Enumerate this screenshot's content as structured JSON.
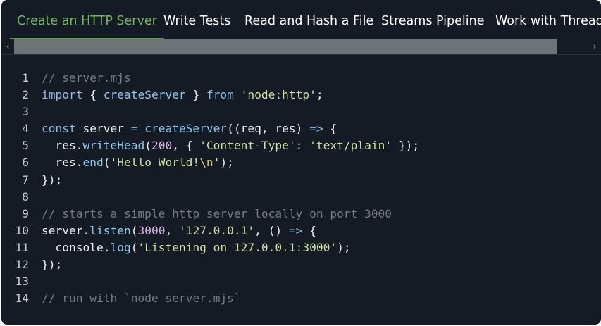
{
  "tabs": [
    {
      "label": "Create an HTTP Server",
      "active": true
    },
    {
      "label": "Write Tests",
      "active": false
    },
    {
      "label": "Read and Hash a File",
      "active": false
    },
    {
      "label": "Streams Pipeline",
      "active": false
    },
    {
      "label": "Work with Threads",
      "active": false
    }
  ],
  "scrollbar": {
    "left_arrow": "‹",
    "right_arrow": "›"
  },
  "colors": {
    "background": "#141b24",
    "active_tab": "#77b564",
    "comment": "#717b87",
    "keyword": "#8fb8e0",
    "string": "#c9e0a4",
    "number": "#dcb3e8",
    "function": "#8fc6f0"
  },
  "code": {
    "language": "javascript",
    "lines": [
      {
        "n": "1",
        "tokens": [
          [
            "comment",
            "// server.mjs"
          ]
        ]
      },
      {
        "n": "2",
        "tokens": [
          [
            "keyword",
            "import"
          ],
          [
            "plain",
            " { "
          ],
          [
            "func",
            "createServer"
          ],
          [
            "plain",
            " } "
          ],
          [
            "keyword",
            "from"
          ],
          [
            "plain",
            " "
          ],
          [
            "string",
            "'node:http'"
          ],
          [
            "plain",
            ";"
          ]
        ]
      },
      {
        "n": "3",
        "tokens": []
      },
      {
        "n": "4",
        "tokens": [
          [
            "keyword",
            "const"
          ],
          [
            "plain",
            " server "
          ],
          [
            "op",
            "="
          ],
          [
            "plain",
            " "
          ],
          [
            "func",
            "createServer"
          ],
          [
            "plain",
            "((req, res) "
          ],
          [
            "op",
            "=>"
          ],
          [
            "plain",
            " {"
          ]
        ]
      },
      {
        "n": "5",
        "tokens": [
          [
            "plain",
            "  res."
          ],
          [
            "func",
            "writeHead"
          ],
          [
            "plain",
            "("
          ],
          [
            "number",
            "200"
          ],
          [
            "plain",
            ", { "
          ],
          [
            "string",
            "'Content-Type'"
          ],
          [
            "plain",
            ": "
          ],
          [
            "string",
            "'text/plain'"
          ],
          [
            "plain",
            " });"
          ]
        ]
      },
      {
        "n": "6",
        "tokens": [
          [
            "plain",
            "  res."
          ],
          [
            "func",
            "end"
          ],
          [
            "plain",
            "("
          ],
          [
            "string",
            "'Hello World!"
          ],
          [
            "escape",
            "\\n"
          ],
          [
            "string",
            "'"
          ],
          [
            "plain",
            ");"
          ]
        ]
      },
      {
        "n": "7",
        "tokens": [
          [
            "plain",
            "});"
          ]
        ]
      },
      {
        "n": "8",
        "tokens": []
      },
      {
        "n": "9",
        "tokens": [
          [
            "comment",
            "// starts a simple http server locally on port 3000"
          ]
        ]
      },
      {
        "n": "10",
        "tokens": [
          [
            "plain",
            "server."
          ],
          [
            "func",
            "listen"
          ],
          [
            "plain",
            "("
          ],
          [
            "number",
            "3000"
          ],
          [
            "plain",
            ", "
          ],
          [
            "string",
            "'127.0.0.1'"
          ],
          [
            "plain",
            ", () "
          ],
          [
            "op",
            "=>"
          ],
          [
            "plain",
            " {"
          ]
        ]
      },
      {
        "n": "11",
        "tokens": [
          [
            "plain",
            "  console."
          ],
          [
            "func",
            "log"
          ],
          [
            "plain",
            "("
          ],
          [
            "string",
            "'Listening on 127.0.0.1:3000'"
          ],
          [
            "plain",
            ");"
          ]
        ]
      },
      {
        "n": "12",
        "tokens": [
          [
            "plain",
            "});"
          ]
        ]
      },
      {
        "n": "13",
        "tokens": []
      },
      {
        "n": "14",
        "tokens": [
          [
            "comment",
            "// run with `node server.mjs`"
          ]
        ]
      }
    ]
  }
}
